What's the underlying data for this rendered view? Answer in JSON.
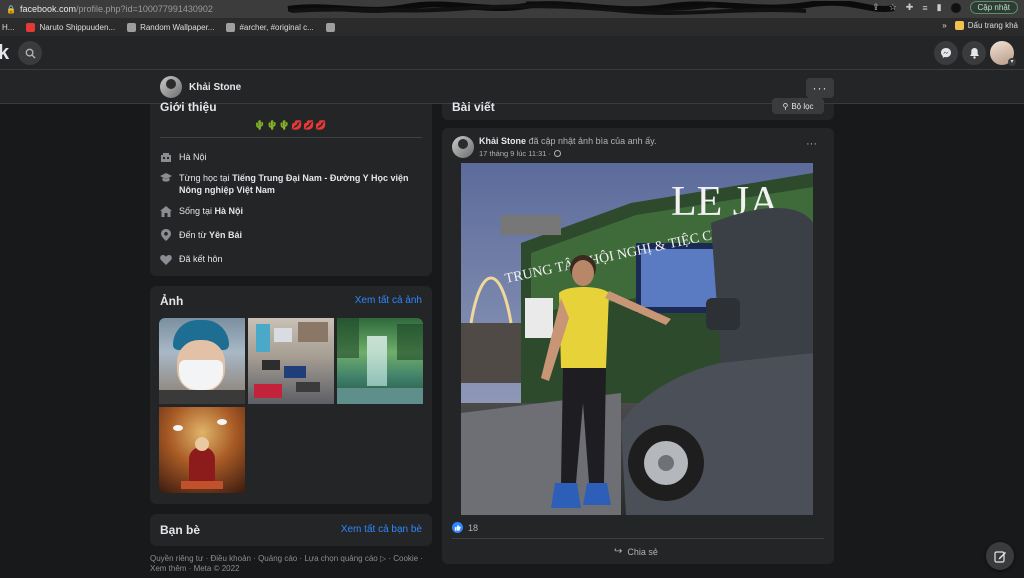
{
  "browser": {
    "url_host": "facebook.com",
    "url_path": "/profile.php?id=100077991430902",
    "update_label": "Cập nhật",
    "bookmarks": [
      {
        "label": "H...",
        "color": "#6a6a6a"
      },
      {
        "label": "Naruto Shippuuden...",
        "color": "#e53935"
      },
      {
        "label": "Random Wallpaper...",
        "color": "#9e9e9e"
      },
      {
        "label": "#archer, #original c...",
        "color": "#9e9e9e"
      }
    ],
    "bookmark_overflow": "»",
    "bookmark_folder": "Dấu trang khá"
  },
  "nav": {
    "logo_fragment": "k",
    "icons": [
      "search-icon",
      "messenger-icon",
      "notifications-icon",
      "account-avatar"
    ]
  },
  "profile": {
    "name": "Khải Stone",
    "more_label": "···"
  },
  "intro": {
    "title": "Giới thiệu",
    "bio_emoji": "🌵🌵🌵💋💋💋",
    "items": [
      {
        "icon": "home-icon",
        "parts": [
          {
            "t": "Hà Nội",
            "b": false
          }
        ]
      },
      {
        "icon": "education-icon",
        "parts": [
          {
            "t": "Từng học tại ",
            "b": false
          },
          {
            "t": "Tiếng Trung Đại Nam - Đường Y Học viện Nông nghiệp Việt Nam",
            "b": true
          }
        ]
      },
      {
        "icon": "house-icon",
        "parts": [
          {
            "t": "Sống tại ",
            "b": false
          },
          {
            "t": "Hà Nội",
            "b": true
          }
        ]
      },
      {
        "icon": "location-icon",
        "parts": [
          {
            "t": "Đến từ ",
            "b": false
          },
          {
            "t": "Yên Bái",
            "b": true
          }
        ]
      },
      {
        "icon": "heart-icon",
        "parts": [
          {
            "t": "Đã kết hôn",
            "b": false
          }
        ]
      }
    ]
  },
  "photos": {
    "title": "Ảnh",
    "see_all": "Xem tất cả ảnh"
  },
  "friends": {
    "title": "Bạn bè",
    "see_all": "Xem tất cả bạn bè"
  },
  "footer": {
    "text": "Quyền riêng tư · Điều khoản · Quảng cáo · Lựa chọn quảng cáo ▷ · Cookie · Xem thêm · Meta © 2022"
  },
  "posts": {
    "title": "Bài viết",
    "filter_label": "Bộ lọc"
  },
  "post": {
    "author": "Khải Stone",
    "action": " đã cập nhật ảnh bìa của anh ấy.",
    "time": "17 tháng 9 lúc 11:31 ·",
    "more_label": "···",
    "photo_sign_main": "LE JA",
    "photo_sign_sub": "TRUNG TÂM HỘI NGHỊ & TIỆC CƯỚI",
    "reaction_count": "18",
    "share_label": "Chia sẻ"
  }
}
